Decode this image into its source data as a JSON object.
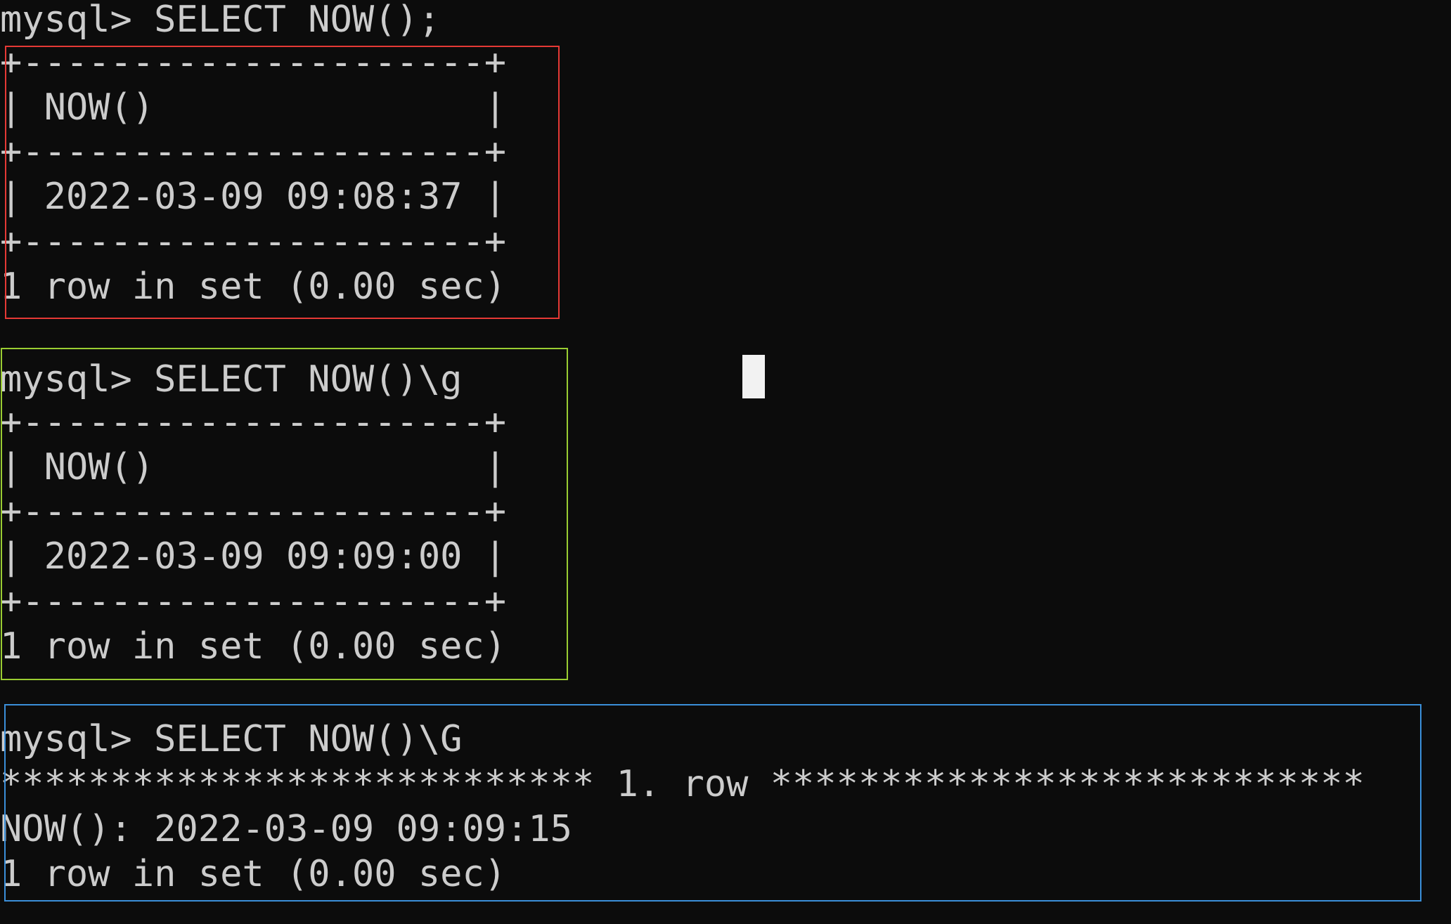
{
  "terminal": {
    "lines": [
      "mysql> SELECT NOW();",
      "+---------------------+",
      "| NOW()               |",
      "+---------------------+",
      "| 2022-03-09 09:08:37 |",
      "+---------------------+",
      "1 row in set (0.00 sec)",
      "",
      "mysql> SELECT NOW()\\g",
      "+---------------------+",
      "| NOW()               |",
      "+---------------------+",
      "| 2022-03-09 09:09:00 |",
      "+---------------------+",
      "1 row in set (0.00 sec)",
      "",
      "mysql> SELECT NOW()\\G",
      "*************************** 1. row ***************************",
      "NOW(): 2022-03-09 09:09:15",
      "1 row in set (0.00 sec)"
    ]
  },
  "highlight_colors": {
    "box1": "#e53935",
    "box2": "#9acd32",
    "box3": "#3b8fd9"
  }
}
